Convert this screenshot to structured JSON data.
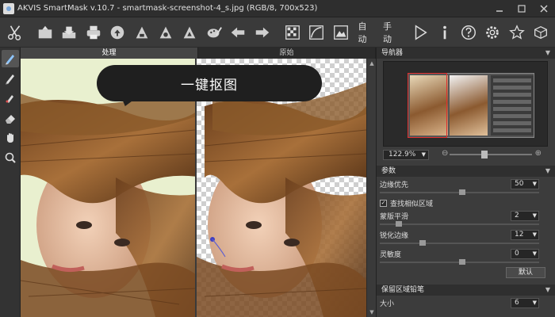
{
  "window": {
    "title": "AKVIS SmartMask v.10.7 - smartmask-screenshot-4_s.jpg (RGB/8, 700x523)"
  },
  "toolbar": {
    "mode_auto": "自动",
    "mode_manual": "手动"
  },
  "tabs": {
    "before": "处理",
    "after": "原始"
  },
  "overlay": {
    "bubble_text": "一键抠图"
  },
  "navigator": {
    "title": "导航器",
    "zoom_value": "122.9%"
  },
  "params": {
    "title": "参数",
    "edge_priority_label": "边缘优先",
    "edge_priority_value": "50",
    "find_similar_label": "查找相似区域",
    "find_similar_checked": true,
    "mask_smooth_label": "蒙版平滑",
    "mask_smooth_value": "2",
    "sharpen_edge_label": "锐化边缘",
    "sharpen_edge_value": "12",
    "sensitivity_label": "灵敏度",
    "sensitivity_value": "0",
    "default_button": "默认"
  },
  "keep_pencil": {
    "title": "保留区域铅笔",
    "size_label": "大小",
    "size_value": "6"
  }
}
